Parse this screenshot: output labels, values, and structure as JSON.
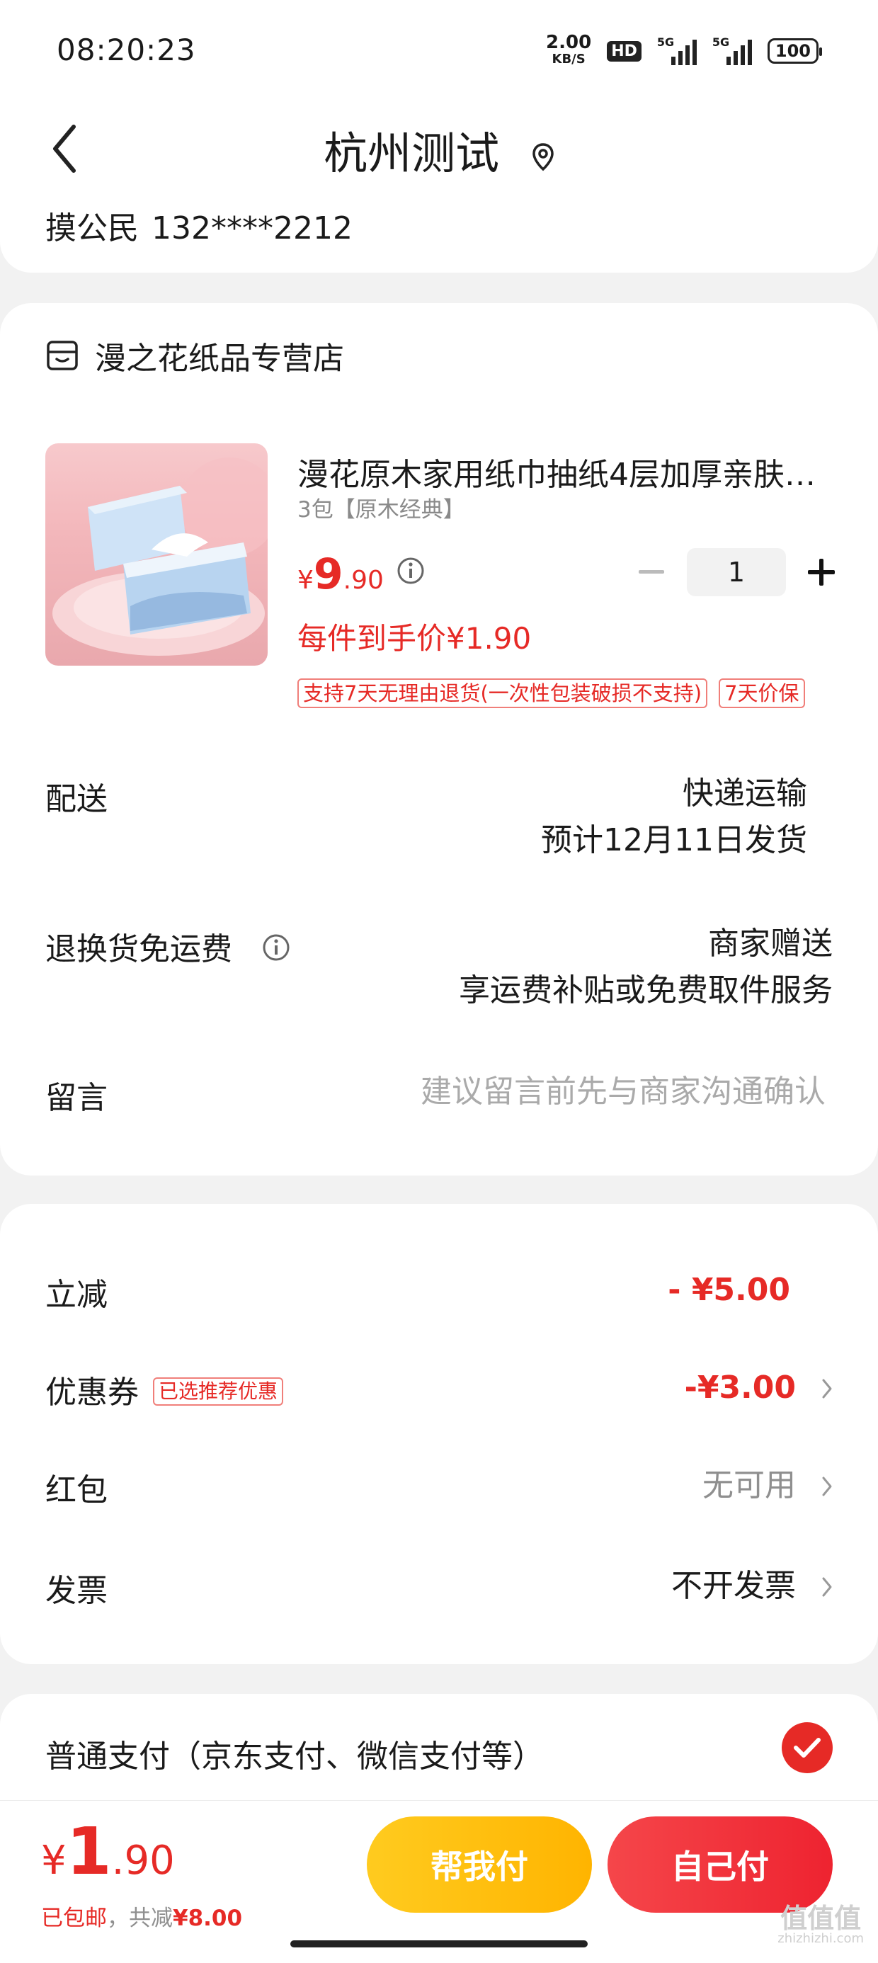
{
  "status_bar": {
    "time": "08:20:23",
    "net_speed": "2.00",
    "net_unit": "KB/S",
    "hd": "HD",
    "signal1": "5G",
    "signal2": "5G",
    "battery": "100"
  },
  "address": {
    "title": "杭州测试",
    "name": "摸公民",
    "phone": "132****2212"
  },
  "shop": {
    "name": "漫之花纸品专营店"
  },
  "product": {
    "title": "漫花原木家用纸巾抽纸4层加厚亲肤…",
    "spec": "3包【原木经典】",
    "price_currency": "¥",
    "price_int": "9",
    "price_dec": ".90",
    "quantity": "1",
    "unit_price": "每件到手价¥1.90",
    "tags": [
      "支持7天无理由退货(一次性包装破损不支持)",
      "7天价保"
    ]
  },
  "delivery": {
    "label": "配送",
    "method": "快递运输",
    "eta": "预计12月11日发货"
  },
  "return_shipping": {
    "label": "退换货免运费",
    "value": "商家赠送",
    "desc": "享运费补贴或免费取件服务"
  },
  "message": {
    "label": "留言",
    "placeholder": "建议留言前先与商家沟通确认"
  },
  "discounts": {
    "instant_label": "立减",
    "instant_value": "- ¥5.00",
    "coupon_label": "优惠券",
    "coupon_tag": "已选推荐优惠",
    "coupon_value": "-¥3.00",
    "redpacket_label": "红包",
    "redpacket_value": "无可用",
    "invoice_label": "发票",
    "invoice_value": "不开发票"
  },
  "payment": {
    "method": "普通支付（京东支付、微信支付等）"
  },
  "bottom": {
    "currency": "¥",
    "total_int": "1",
    "total_dec": ".90",
    "free_shipping": "已包邮",
    "sep": "，",
    "saved_label": "共减",
    "saved_value": "¥8.00",
    "help_pay": "帮我付",
    "self_pay": "自己付"
  },
  "watermark": {
    "main": "值值值",
    "sub": "zhizhizhi.com"
  },
  "colors": {
    "accent_red": "#e62a26",
    "help_yellow": "#ffb400",
    "page_bg": "#f2f2f2"
  }
}
